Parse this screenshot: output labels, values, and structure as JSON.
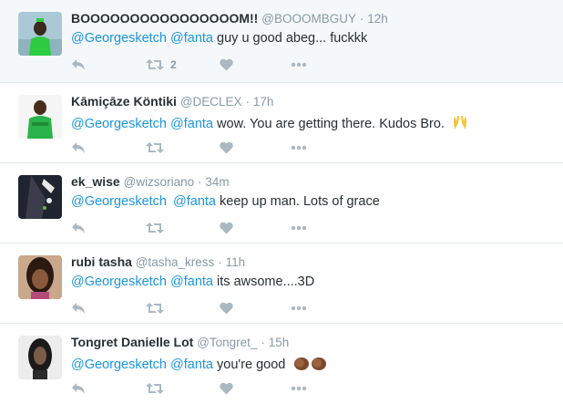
{
  "tweets": [
    {
      "name": "BOOOOOOOOOOOOOOOOM!!",
      "handle": "@BOOOMBGUY",
      "time": "12h",
      "mention1": "@Georgesketch",
      "mention2": "@fanta",
      "body": "guy u good abeg... fuckkk",
      "retweet_count": "2",
      "emoji": "",
      "avatar_colors": [
        "#a9c9d6",
        "#2ecc40",
        "#3a2a1d"
      ]
    },
    {
      "name": "Kāmiçāze Köntiki",
      "handle": "@DECLEX",
      "time": "17h",
      "mention1": "@Georgesketch",
      "mention2": "@fanta",
      "body": "wow. You are getting there. Kudos Bro.",
      "retweet_count": "",
      "emoji": "raised-hands",
      "avatar_colors": [
        "#f5f5f5",
        "#29b34a",
        "#4a2c1a"
      ]
    },
    {
      "name": "ek_wise",
      "handle": "@wizsoriano",
      "time": "34m",
      "mention1": "@Georgesketch",
      "mention2": "@fanta",
      "body": "keep up man. Lots of grace",
      "retweet_count": "",
      "emoji": "",
      "avatar_colors": [
        "#1f2430",
        "#e8e8e8",
        "#3c3c4c"
      ]
    },
    {
      "name": "rubi tasha",
      "handle": "@tasha_kress",
      "time": "11h",
      "mention1": "@Georgesketch",
      "mention2": "@fanta",
      "body": "its awsome....3D",
      "retweet_count": "",
      "emoji": "",
      "avatar_colors": [
        "#c9a88c",
        "#2a1a12",
        "#8a5a3c"
      ]
    },
    {
      "name": "Tongret Danielle Lot",
      "handle": "@Tongret_",
      "time": "15h",
      "mention1": "@Georgesketch",
      "mention2": "@fanta",
      "body": "you're good",
      "retweet_count": "",
      "emoji": "clapping-hands",
      "avatar_colors": [
        "#ececec",
        "#1a1a1a",
        "#7a5a48"
      ]
    }
  ],
  "separator_dot": "·",
  "colors": {
    "link": "#1b95e0",
    "muted": "#8899a6",
    "icon": "#aab8c2",
    "text": "#292f33",
    "border": "#e1e8ed",
    "highlight_bg": "#f5f8fa"
  },
  "icons": [
    "reply-icon",
    "retweet-icon",
    "like-heart-icon",
    "more-dots-icon"
  ]
}
